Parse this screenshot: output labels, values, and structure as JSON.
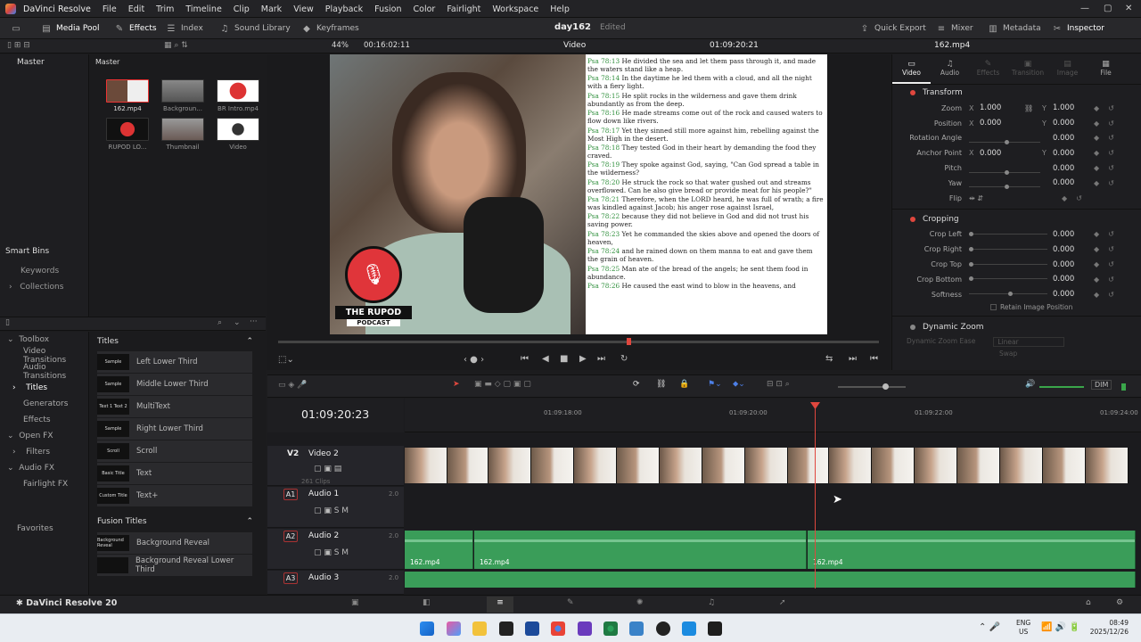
{
  "app": {
    "name": "DaVinci Resolve",
    "menu": [
      "File",
      "Edit",
      "Trim",
      "Timeline",
      "Clip",
      "Mark",
      "View",
      "Playback",
      "Fusion",
      "Color",
      "Fairlight",
      "Workspace",
      "Help"
    ],
    "version_label": "DaVinci Resolve 20"
  },
  "toolbar": {
    "media_pool": "Media Pool",
    "effects": "Effects",
    "index": "Index",
    "sound_library": "Sound Library",
    "keyframes": "Keyframes",
    "project_title": "day162",
    "project_status": "Edited",
    "quick_export": "Quick Export",
    "mixer": "Mixer",
    "metadata": "Metadata",
    "inspector": "Inspector"
  },
  "viewer_bar": {
    "zoom": "44%",
    "source_timecode": "00:16:02:11",
    "mode": "Video",
    "record_timecode": "01:09:20:21",
    "clip_name": "162.mp4"
  },
  "media_pool": {
    "left_header": "Master",
    "right_header": "Master",
    "clips": [
      {
        "name": "162.mp4"
      },
      {
        "name": "Backgroun..."
      },
      {
        "name": "BR Intro.mp4"
      },
      {
        "name": "RUPOD LO..."
      },
      {
        "name": "Thumbnail"
      },
      {
        "name": "Video"
      }
    ],
    "smart_bins": "Smart Bins",
    "keywords": "Keywords",
    "collections": "Collections"
  },
  "effects_panel": {
    "tree": [
      "Toolbox",
      "Video Transitions",
      "Audio Transitions",
      "Titles",
      "Generators",
      "Effects",
      "Open FX",
      "Filters",
      "Audio FX",
      "Fairlight FX"
    ],
    "favorites": "Favorites",
    "titles_header": "Titles",
    "titles": [
      {
        "name": "Left Lower Third",
        "preview": "Sample"
      },
      {
        "name": "Middle Lower Third",
        "preview": "Sample"
      },
      {
        "name": "MultiText",
        "preview": "Text 1 Text 2"
      },
      {
        "name": "Right Lower Third",
        "preview": "Sample"
      },
      {
        "name": "Scroll",
        "preview": "Scroll"
      },
      {
        "name": "Text",
        "preview": "Basic Title"
      },
      {
        "name": "Text+",
        "preview": "Custom Title"
      }
    ],
    "fusion_header": "Fusion Titles",
    "fusion_titles": [
      {
        "name": "Background Reveal",
        "preview": "Background Reveal"
      },
      {
        "name": "Background Reveal Lower Third",
        "preview": ""
      }
    ]
  },
  "viewer": {
    "logo_name": "THE RUPOD",
    "logo_sub": "PODCAST",
    "verses": [
      {
        "ref": "Psa 78:13",
        "text": "He divided the sea and let them pass through it, and made the waters stand like a heap."
      },
      {
        "ref": "Psa 78:14",
        "text": "In the daytime he led them with a cloud, and all the night with a fiery light."
      },
      {
        "ref": "Psa 78:15",
        "text": "He split rocks in the wilderness and gave them drink abundantly as from the deep."
      },
      {
        "ref": "Psa 78:16",
        "text": "He made streams come out of the rock and caused waters to flow down like rivers."
      },
      {
        "ref": "Psa 78:17",
        "text": "Yet they sinned still more against him, rebelling against the Most High in the desert."
      },
      {
        "ref": "Psa 78:18",
        "text": "They tested God in their heart by demanding the food they craved."
      },
      {
        "ref": "Psa 78:19",
        "text": "They spoke against God, saying, \"Can God spread a table in the wilderness?"
      },
      {
        "ref": "Psa 78:20",
        "text": "He struck the rock so that water gushed out and streams overflowed. Can he also give bread or provide meat for his people?\""
      },
      {
        "ref": "Psa 78:21",
        "text": "Therefore, when the LORD heard, he was full of wrath; a fire was kindled against Jacob; his anger rose against Israel,"
      },
      {
        "ref": "Psa 78:22",
        "text": "because they did not believe in God and did not trust his saving power."
      },
      {
        "ref": "Psa 78:23",
        "text": "Yet he commanded the skies above and opened the doors of heaven,"
      },
      {
        "ref": "Psa 78:24",
        "text": "and he rained down on them manna to eat and gave them the grain of heaven."
      },
      {
        "ref": "Psa 78:25",
        "text": "Man ate of the bread of the angels; he sent them food in abundance."
      },
      {
        "ref": "Psa 78:26",
        "text": "He caused the east wind to blow in the heavens, and"
      }
    ]
  },
  "inspector": {
    "tabs": [
      "Video",
      "Audio",
      "Effects",
      "Transition",
      "Image",
      "File"
    ],
    "transform": {
      "title": "Transform",
      "rows": [
        {
          "name": "Zoom",
          "axis1": "X",
          "v1": "1.000",
          "axis2": "Y",
          "v2": "1.000"
        },
        {
          "name": "Position",
          "axis1": "X",
          "v1": "0.000",
          "axis2": "Y",
          "v2": "0.000"
        },
        {
          "name": "Rotation Angle",
          "v2": "0.000"
        },
        {
          "name": "Anchor Point",
          "axis1": "X",
          "v1": "0.000",
          "axis2": "Y",
          "v2": "0.000"
        },
        {
          "name": "Pitch",
          "v2": "0.000"
        },
        {
          "name": "Yaw",
          "v2": "0.000"
        },
        {
          "name": "Flip"
        }
      ]
    },
    "cropping": {
      "title": "Cropping",
      "rows": [
        {
          "name": "Crop Left",
          "v": "0.000"
        },
        {
          "name": "Crop Right",
          "v": "0.000"
        },
        {
          "name": "Crop Top",
          "v": "0.000"
        },
        {
          "name": "Crop Bottom",
          "v": "0.000"
        },
        {
          "name": "Softness",
          "v": "0.000"
        }
      ],
      "retain": "Retain Image Position"
    },
    "dynamic_zoom": {
      "title": "Dynamic Zoom",
      "ease_label": "Dynamic Zoom Ease",
      "ease_value": "Linear",
      "swap": "Swap"
    }
  },
  "timeline": {
    "timecode": "01:09:20:23",
    "ruler": [
      "01:09:18:00",
      "01:09:20:00",
      "01:09:22:00",
      "01:09:24:00"
    ],
    "dim": "DIM",
    "tracks": [
      {
        "id": "V2",
        "name": "Video 2",
        "sub": "261 Clips"
      },
      {
        "id": "A1",
        "name": "Audio 1",
        "level": "2.0"
      },
      {
        "id": "A2",
        "name": "Audio 2",
        "level": "2.0"
      },
      {
        "id": "A3",
        "name": "Audio 3",
        "level": "2.0"
      }
    ],
    "audio_clips": [
      "162.mp4",
      "162.mp4",
      "162.mp4"
    ]
  },
  "taskbar": {
    "lang1": "ENG",
    "lang2": "US",
    "time": "08:49",
    "date": "2025/12/26"
  }
}
